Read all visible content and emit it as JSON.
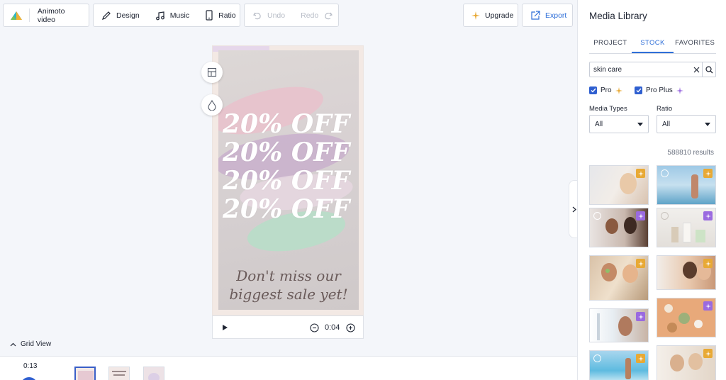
{
  "toolbar": {
    "project_label": "Animoto video",
    "design_label": "Design",
    "music_label": "Music",
    "ratio_label": "Ratio",
    "undo_label": "Undo",
    "redo_label": "Redo",
    "upgrade_label": "Upgrade",
    "export_label": "Export"
  },
  "canvas": {
    "headline_lines": [
      "20% OFF",
      "20% OFF",
      "20% OFF",
      "20% OFF"
    ],
    "sub_line1": "Don't miss our",
    "sub_line2": "biggest sale yet!"
  },
  "player": {
    "time": "0:04"
  },
  "grid_view_label": "Grid View",
  "timeline": {
    "duration": "0:13"
  },
  "library": {
    "title": "Media Library",
    "tabs": [
      "PROJECT",
      "STOCK",
      "FAVORITES"
    ],
    "active_tab": "STOCK",
    "search_value": "skin care",
    "filter_pro": "Pro",
    "filter_pro_plus": "Pro Plus",
    "media_types_label": "Media Types",
    "media_types_value": "All",
    "ratio_label": "Ratio",
    "ratio_value": "All",
    "results": "588810 results"
  },
  "colors": {
    "accent_blue": "#2f6fd8",
    "pro_badge": "#e8a935",
    "pro_plus_badge": "#9a6ae0"
  }
}
